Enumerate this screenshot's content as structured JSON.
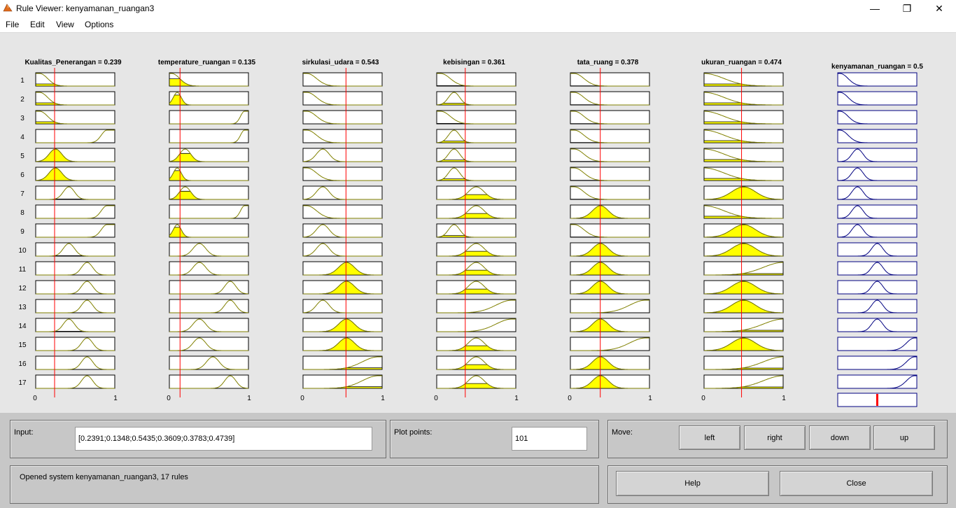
{
  "window": {
    "title": "Rule Viewer: kenyamanan_ruangan3",
    "minimize_glyph": "—",
    "maximize_glyph": "❐",
    "close_glyph": "✕"
  },
  "menu": [
    "File",
    "Edit",
    "View",
    "Options"
  ],
  "inputs": [
    {
      "name": "Kualitas_Penerangan",
      "value": 0.239,
      "label": "Kualitas_Penerangan = 0.239"
    },
    {
      "name": "temperature_ruangan",
      "value": 0.135,
      "label": "temperature_ruangan = 0.135"
    },
    {
      "name": "sirkulasi_udara",
      "value": 0.543,
      "label": "sirkulasi_udara = 0.543"
    },
    {
      "name": "kebisingan",
      "value": 0.361,
      "label": "kebisingan = 0.361"
    },
    {
      "name": "tata_ruang",
      "value": 0.378,
      "label": "tata_ruang = 0.378"
    },
    {
      "name": "ukuran_ruangan",
      "value": 0.474,
      "label": "ukuran_ruangan = 0.474"
    }
  ],
  "output": {
    "name": "kenyamanan_ruangan",
    "value": 0.5,
    "label": "kenyamanan_ruangan = 0.5"
  },
  "axis_ticks": [
    "0",
    "1"
  ],
  "rule_numbers": [
    "1",
    "2",
    "3",
    "4",
    "5",
    "6",
    "7",
    "8",
    "9",
    "10",
    "11",
    "12",
    "13",
    "14",
    "15",
    "16",
    "17"
  ],
  "membership_functions": {
    "inputs": [
      [
        [
          "z",
          0.05,
          0.1
        ],
        [
          "z",
          0.05,
          0.1
        ],
        [
          "z",
          0.05,
          0.1
        ],
        [
          "s",
          0.9,
          0.07
        ],
        [
          "g",
          0.25,
          0.08
        ],
        [
          "g",
          0.25,
          0.08
        ],
        [
          "g",
          0.42,
          0.07
        ],
        [
          "s",
          0.9,
          0.07
        ],
        [
          "s",
          0.9,
          0.07
        ],
        [
          "g",
          0.42,
          0.07
        ],
        [
          "g",
          0.65,
          0.07
        ],
        [
          "g",
          0.65,
          0.07
        ],
        [
          "g",
          0.65,
          0.07
        ],
        [
          "g",
          0.42,
          0.07
        ],
        [
          "g",
          0.65,
          0.07
        ],
        [
          "g",
          0.65,
          0.07
        ],
        [
          "g",
          0.65,
          0.07
        ]
      ],
      [
        [
          "z",
          0.03,
          0.1
        ],
        [
          "g",
          0.1,
          0.05
        ],
        [
          "s",
          0.95,
          0.05
        ],
        [
          "s",
          0.95,
          0.05
        ],
        [
          "g",
          0.2,
          0.07
        ],
        [
          "g",
          0.1,
          0.05
        ],
        [
          "g",
          0.2,
          0.07
        ],
        [
          "s",
          0.95,
          0.05
        ],
        [
          "g",
          0.1,
          0.05
        ],
        [
          "g",
          0.38,
          0.08
        ],
        [
          "g",
          0.38,
          0.08
        ],
        [
          "g",
          0.77,
          0.07
        ],
        [
          "g",
          0.77,
          0.07
        ],
        [
          "g",
          0.38,
          0.08
        ],
        [
          "g",
          0.38,
          0.08
        ],
        [
          "g",
          0.55,
          0.08
        ],
        [
          "g",
          0.77,
          0.07
        ]
      ],
      [
        [
          "z",
          0.05,
          0.12
        ],
        [
          "z",
          0.05,
          0.12
        ],
        [
          "z",
          0.05,
          0.12
        ],
        [
          "z",
          0.05,
          0.12
        ],
        [
          "g",
          0.25,
          0.08
        ],
        [
          "z",
          0.05,
          0.12
        ],
        [
          "g",
          0.25,
          0.08
        ],
        [
          "z",
          0.05,
          0.12
        ],
        [
          "g",
          0.25,
          0.08
        ],
        [
          "g",
          0.25,
          0.08
        ],
        [
          "g",
          0.55,
          0.1
        ],
        [
          "g",
          0.55,
          0.1
        ],
        [
          "g",
          0.25,
          0.08
        ],
        [
          "g",
          0.55,
          0.1
        ],
        [
          "g",
          0.55,
          0.1
        ],
        [
          "s",
          0.95,
          0.2
        ],
        [
          "s",
          0.95,
          0.2
        ]
      ],
      [
        [
          "z",
          0.05,
          0.12
        ],
        [
          "g",
          0.22,
          0.07
        ],
        [
          "z",
          0.05,
          0.12
        ],
        [
          "g",
          0.22,
          0.07
        ],
        [
          "g",
          0.22,
          0.07
        ],
        [
          "g",
          0.22,
          0.07
        ],
        [
          "g",
          0.5,
          0.1
        ],
        [
          "g",
          0.5,
          0.1
        ],
        [
          "g",
          0.22,
          0.07
        ],
        [
          "g",
          0.5,
          0.1
        ],
        [
          "g",
          0.5,
          0.1
        ],
        [
          "g",
          0.5,
          0.1
        ],
        [
          "s",
          0.95,
          0.2
        ],
        [
          "s",
          0.95,
          0.2
        ],
        [
          "g",
          0.5,
          0.1
        ],
        [
          "g",
          0.5,
          0.1
        ],
        [
          "g",
          0.5,
          0.1
        ]
      ],
      [
        [
          "z",
          0.05,
          0.12
        ],
        [
          "z",
          0.05,
          0.12
        ],
        [
          "z",
          0.05,
          0.12
        ],
        [
          "z",
          0.05,
          0.12
        ],
        [
          "z",
          0.05,
          0.12
        ],
        [
          "z",
          0.05,
          0.12
        ],
        [
          "z",
          0.05,
          0.12
        ],
        [
          "g",
          0.38,
          0.1
        ],
        [
          "z",
          0.05,
          0.12
        ],
        [
          "g",
          0.38,
          0.1
        ],
        [
          "g",
          0.38,
          0.1
        ],
        [
          "g",
          0.38,
          0.1
        ],
        [
          "s",
          0.95,
          0.2
        ],
        [
          "g",
          0.38,
          0.1
        ],
        [
          "s",
          0.95,
          0.2
        ],
        [
          "g",
          0.38,
          0.1
        ],
        [
          "g",
          0.38,
          0.1
        ]
      ],
      [
        [
          "z",
          0.0,
          0.25
        ],
        [
          "z",
          0.0,
          0.25
        ],
        [
          "z",
          0.0,
          0.25
        ],
        [
          "z",
          0.0,
          0.25
        ],
        [
          "z",
          0.0,
          0.25
        ],
        [
          "z",
          0.0,
          0.25
        ],
        [
          "g",
          0.5,
          0.15
        ],
        [
          "z",
          0.0,
          0.25
        ],
        [
          "g",
          0.5,
          0.15
        ],
        [
          "g",
          0.5,
          0.15
        ],
        [
          "s",
          1.0,
          0.25
        ],
        [
          "g",
          0.5,
          0.15
        ],
        [
          "g",
          0.5,
          0.15
        ],
        [
          "s",
          1.0,
          0.25
        ],
        [
          "g",
          0.5,
          0.15
        ],
        [
          "s",
          1.0,
          0.25
        ],
        [
          "s",
          1.0,
          0.25
        ]
      ]
    ],
    "output": [
      [
        "z",
        0.03,
        0.1
      ],
      [
        "z",
        0.03,
        0.1
      ],
      [
        "z",
        0.03,
        0.1
      ],
      [
        "z",
        0.03,
        0.1
      ],
      [
        "g",
        0.25,
        0.07
      ],
      [
        "g",
        0.25,
        0.07
      ],
      [
        "g",
        0.25,
        0.07
      ],
      [
        "g",
        0.25,
        0.07
      ],
      [
        "g",
        0.25,
        0.07
      ],
      [
        "g",
        0.5,
        0.07
      ],
      [
        "g",
        0.5,
        0.07
      ],
      [
        "g",
        0.5,
        0.07
      ],
      [
        "g",
        0.5,
        0.07
      ],
      [
        "g",
        0.5,
        0.07
      ],
      [
        "s",
        0.97,
        0.1
      ],
      [
        "s",
        0.97,
        0.1
      ],
      [
        "s",
        0.97,
        0.1
      ]
    ]
  },
  "colors": {
    "mf_line": "#808000",
    "fill": "#ffff00",
    "marker": "#ff0000",
    "output_line": "#000080",
    "plot_bg": "#e6e6e6",
    "panel_bg": "#c7c7c7"
  },
  "controls": {
    "input_label": "Input:",
    "input_value": "[0.2391;0.1348;0.5435;0.3609;0.3783;0.4739]",
    "plot_points_label": "Plot points:",
    "plot_points_value": "101",
    "move_label": "Move:",
    "move_buttons": [
      "left",
      "right",
      "down",
      "up"
    ],
    "status_text": "Opened system kenyamanan_ruangan3, 17 rules",
    "help_label": "Help",
    "close_label": "Close"
  }
}
